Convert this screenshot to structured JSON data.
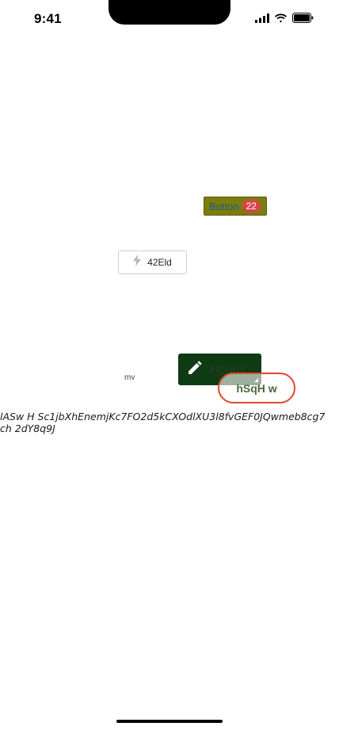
{
  "status_bar": {
    "time": "9:41",
    "icons": [
      "cellular-signal-icon",
      "wifi-icon",
      "battery-icon"
    ]
  },
  "badge_button": {
    "label": "Button",
    "badge_count": "22",
    "background_color": "#7c7c0f",
    "label_color": "#1b5e87",
    "badge_color": "#d64545"
  },
  "outline_button": {
    "icon": "lightning-bolt-icon",
    "label": "42Eld"
  },
  "small_text": "mv",
  "edit_button": {
    "icon": "pencil-icon",
    "label": "HQuq5",
    "background_color": "#0e3b12"
  },
  "pill_button": {
    "label": "hSqH w",
    "border_color": "#e0482f",
    "label_color": "#4a6a3a"
  },
  "paragraph": "lASw H Sc1jbXhEnemjKc7FO2d5kCXOdlXU3l8fvGEF0JQwmeb8cg7ch 2dY8q9J"
}
